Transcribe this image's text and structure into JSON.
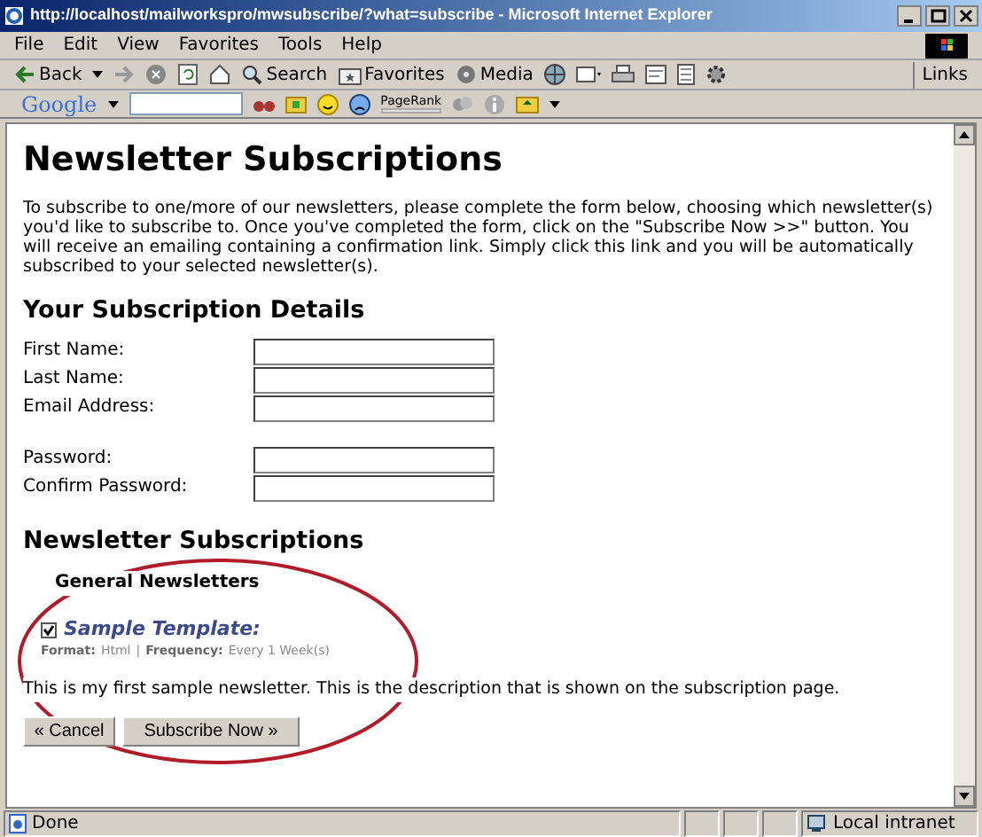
{
  "window": {
    "title": "http://localhost/mailworkspro/mwsubscribe/?what=subscribe - Microsoft Internet Explorer"
  },
  "menu": [
    "File",
    "Edit",
    "View",
    "Favorites",
    "Tools",
    "Help"
  ],
  "toolbar": {
    "back": "Back",
    "search": "Search",
    "favorites": "Favorites",
    "media": "Media",
    "links": "Links"
  },
  "google_bar": {
    "logo": "Google",
    "pagerank": "PageRank"
  },
  "page": {
    "title": "Newsletter Subscriptions",
    "intro": "To subscribe to one/more of our newsletters, please complete the form below, choosing which newsletter(s) you'd like to subscribe to. Once you've completed the form, click on the \"Subscribe Now >>\" button. You will receive an emailing containing a confirmation link. Simply click this link and you will be automatically subscribed to your selected newsletter(s).",
    "details_heading": "Your Subscription Details",
    "field_groups": [
      [
        {
          "label": "First Name:"
        },
        {
          "label": "Last Name:"
        },
        {
          "label": "Email Address:"
        }
      ],
      [
        {
          "label": "Password:"
        },
        {
          "label": "Confirm Password:"
        }
      ]
    ],
    "subscriptions_heading": "Newsletter Subscriptions",
    "group": "General Newsletters",
    "newsletters": [
      {
        "name": "Sample Template:",
        "checked": true,
        "format_label": "Format:",
        "format": "Html",
        "separator": "|",
        "frequency_label": "Frequency:",
        "frequency": "Every 1 Week(s)",
        "description": "This is my first sample newsletter. This is the description that is shown on the subscription page."
      }
    ],
    "buttons": [
      "« Cancel",
      "Subscribe Now »"
    ]
  },
  "status_bar": {
    "text": "Done",
    "zone": "Local intranet"
  }
}
